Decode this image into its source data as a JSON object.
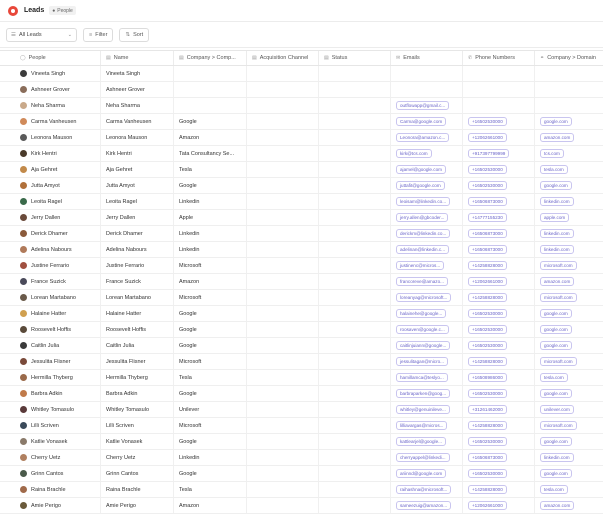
{
  "header": {
    "title": "Leads",
    "badge": "People"
  },
  "toolbar": {
    "view": "All Leads",
    "filter": "Filter",
    "sort": "Sort"
  },
  "columns": [
    "People",
    "Name",
    "Company > Comp...",
    "Acquisition Channel",
    "Status",
    "Emails",
    "Phone Numbers",
    "Company > Domain"
  ],
  "colors": {
    "accent": "#6a64c9",
    "logo": "#e8473a"
  },
  "rows": [
    {
      "people": "Vineeta Singh",
      "name": "Vineeta Singh",
      "company": "",
      "email": "",
      "phone": "",
      "domain": "",
      "av": "#3b3b3b"
    },
    {
      "people": "Ashneer Grover",
      "name": "Ashneer Grover",
      "company": "",
      "email": "",
      "phone": "",
      "domain": "",
      "av": "#8a6d5a"
    },
    {
      "people": "Neha Sharma",
      "name": "Neha Sharma",
      "company": "",
      "email": "outflowapp@gmail.c...",
      "phone": "",
      "domain": "",
      "av": "#c9a98a"
    },
    {
      "people": "Carma Vanheusen",
      "name": "Carma Vanheusen",
      "company": "Google",
      "email": "Carma@google.com",
      "phone": "+16502530000",
      "domain": "google.com",
      "av": "#d08a5a"
    },
    {
      "people": "Leonora Mauson",
      "name": "Leonora Mauson",
      "company": "Amazon",
      "email": "Leonora@amazon.c...",
      "phone": "+12062661000",
      "domain": "amazon.com",
      "av": "#5a5a5a"
    },
    {
      "people": "Kirk Hentri",
      "name": "Kirk Hentri",
      "company": "Tata Consultancy Se...",
      "email": "kirk@tcs.com",
      "phone": "+917397799999",
      "domain": "tcs.com",
      "av": "#4a3a2a"
    },
    {
      "people": "Aja Gehret",
      "name": "Aja Gehret",
      "company": "Tesla",
      "email": "ajamel@google.com",
      "phone": "+16502530000",
      "domain": "tesla.com",
      "av": "#c28a4a"
    },
    {
      "people": "Jutta Amyot",
      "name": "Jutta Amyot",
      "company": "Google",
      "email": "juttafit@google.com",
      "phone": "+16502530000",
      "domain": "google.com",
      "av": "#b0703a"
    },
    {
      "people": "Leoita Ragel",
      "name": "Leoita Ragel",
      "company": "Linkedin",
      "email": "leoisam@linkedin.co...",
      "phone": "+16506873000",
      "domain": "linkedin.com",
      "av": "#3a6a4a"
    },
    {
      "people": "Jerry Dallen",
      "name": "Jerry Dallen",
      "company": "Apple",
      "email": "jerry.allen@gbcoder...",
      "phone": "+14777155230",
      "domain": "apple.com",
      "av": "#6a4a3a"
    },
    {
      "people": "Derick Dhamer",
      "name": "Derick Dhamer",
      "company": "Linkedin",
      "email": "derickm@linkedin.co...",
      "phone": "+16506873000",
      "domain": "linkedin.com",
      "av": "#8a5a3a"
    },
    {
      "people": "Adelina Nabours",
      "name": "Adelina Nabours",
      "company": "Linkedin",
      "email": "adelinan@linkedin.c...",
      "phone": "+16506873000",
      "domain": "linkedin.com",
      "av": "#b07a5a"
    },
    {
      "people": "Justine Ferrario",
      "name": "Justine Ferrario",
      "company": "Microsoft",
      "email": "justinenc@micros...",
      "phone": "+14258828000",
      "domain": "microsoft.com",
      "av": "#a05040"
    },
    {
      "people": "France Suzick",
      "name": "France Suzick",
      "company": "Amazon",
      "email": "francoreve@amazo...",
      "phone": "+12062661000",
      "domain": "amazon.com",
      "av": "#4a4a5a"
    },
    {
      "people": "Lorean Martabano",
      "name": "Lorean Martabano",
      "company": "Microsoft",
      "email": "loreanyag@microsoft...",
      "phone": "+14258828000",
      "domain": "microsoft.com",
      "av": "#6a5a4a"
    },
    {
      "people": "Halaine Hatter",
      "name": "Halaine Hatter",
      "company": "Google",
      "email": "halainehe@google...",
      "phone": "+16502530000",
      "domain": "google.com",
      "av": "#d0a050"
    },
    {
      "people": "Roosevelt Hoffis",
      "name": "Roosevelt Hoffis",
      "company": "Google",
      "email": "roosaven@google.c...",
      "phone": "+16502530000",
      "domain": "google.com",
      "av": "#5a4a3a"
    },
    {
      "people": "Caitlin Julia",
      "name": "Caitlin Julia",
      "company": "Google",
      "email": "caitlinjuiann@google...",
      "phone": "+16502530000",
      "domain": "google.com",
      "av": "#3a3a3a"
    },
    {
      "people": "Jessulita Flisner",
      "name": "Jessulita Flisner",
      "company": "Microsoft",
      "email": "jessulitagan@micro...",
      "phone": "+14258828000",
      "domain": "microsoft.com",
      "av": "#7a4a3a"
    },
    {
      "people": "Hermilla Thyberg",
      "name": "Hermilla Thyberg",
      "company": "Tesla",
      "email": "hamillamca@teslyo...",
      "phone": "+16508986000",
      "domain": "tesla.com",
      "av": "#9a6a4a"
    },
    {
      "people": "Barbra Adkin",
      "name": "Barbra Adkin",
      "company": "Google",
      "email": "barbraparken@goog...",
      "phone": "+16502530000",
      "domain": "google.com",
      "av": "#c07a4a"
    },
    {
      "people": "Whitley Tomasulo",
      "name": "Whitley Tomasulo",
      "company": "Unilever",
      "email": "whitley@genuinileve...",
      "phone": "+31261462000",
      "domain": "unilever.com",
      "av": "#5a3a3a"
    },
    {
      "people": "Lilli Scriven",
      "name": "Lilli Scriven",
      "company": "Microsoft",
      "email": "lilliavargas@micros...",
      "phone": "+14258828000",
      "domain": "microsoft.com",
      "av": "#3a4a5a"
    },
    {
      "people": "Katlie Vonasek",
      "name": "Katlie Vonasek",
      "company": "Google",
      "email": "kattlearjel@google...",
      "phone": "+16502530000",
      "domain": "google.com",
      "av": "#8a7a6a"
    },
    {
      "people": "Cherry Uetz",
      "name": "Cherry Uetz",
      "company": "Linkedin",
      "email": "cherryappel@linkedi...",
      "phone": "+16506873000",
      "domain": "linkedin.com",
      "av": "#b08060"
    },
    {
      "people": "Grinn Cantos",
      "name": "Grinn Cantos",
      "company": "Google",
      "email": "ariinnd@google.com",
      "phone": "+16502530000",
      "domain": "google.com",
      "av": "#4a5a4a"
    },
    {
      "people": "Raina Brachle",
      "name": "Raina Brachle",
      "company": "Tesla",
      "email": "raihashna@microsoft...",
      "phone": "+14258828000",
      "domain": "tesla.com",
      "av": "#a06a4a"
    },
    {
      "people": "Amie Perigo",
      "name": "Amie Perigo",
      "company": "Amazon",
      "email": "sameezuig@amazon...",
      "phone": "+12062661000",
      "domain": "amazon.com",
      "av": "#6a5a3a"
    }
  ]
}
